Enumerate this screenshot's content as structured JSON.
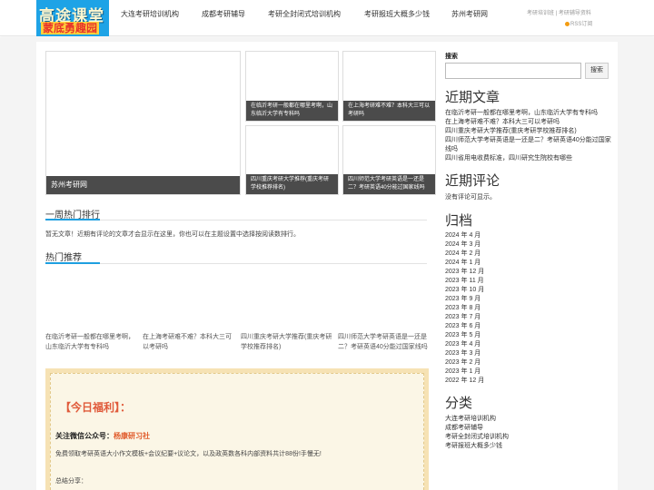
{
  "header": {
    "logo_line1": "高途课堂",
    "logo_line2": "蒙底勇趣园",
    "nav": [
      "大连考研培训机构",
      "成都考研辅导",
      "考研全封闭式培训机构",
      "考研报班大概多少钱",
      "苏州考研网"
    ],
    "top_links": [
      "考研培训班",
      "考研辅导资料"
    ],
    "top_sep": "|",
    "rss_label": "RSS订阅"
  },
  "featured": {
    "big": "苏州考研网",
    "small": [
      "在临沂考研一般都在哪里考啊，山东临沂大学有专科吗",
      "在上海考研难不难？本科大三可以考研吗",
      "四川重庆考研大学推荐(重庆考研学校推荐排名)",
      "四川师范大学考研英语是一还是二？考研英语40分能过国家线吗"
    ]
  },
  "weekly": {
    "title": "一周热门排行",
    "notice": "暂无文章！近期有评论的文章才会显示在这里，你也可以在主题设置中选择按阅读数排行。"
  },
  "hot": {
    "title": "热门推荐",
    "items": [
      "在临沂考研一般都在哪里考啊，山东临沂大学有专科吗",
      "在上海考研难不难？本科大三可以考研吗",
      "四川重庆考研大学推荐(重庆考研学校推荐排名)",
      "四川师范大学考研英语是一还是二？考研英语40分能过国家线吗"
    ]
  },
  "welfare": {
    "title": "【今日福利】：",
    "sub_prefix": "关注微信公众号：",
    "sub_name": "杨康研习社",
    "desc": "免费领取考研英语大小作文模板+会议纪要+议论文，以及政英数各科内部资料共计88份!手慢无!",
    "summary": "总结分享："
  },
  "sidebar": {
    "search_label": "搜索",
    "search_value": "",
    "search_button": "搜索",
    "recent_title": "近期文章",
    "recent": [
      "在临沂考研一般都在哪里考啊，山东临沂大学有专科吗",
      "在上海考研难不难？本科大三可以考研吗",
      "四川重庆考研大学推荐(重庆考研学校推荐排名)",
      "四川师范大学考研英语是一还是二？考研英语40分能过国家线吗",
      "四川省用电收费标准，四川研究生院校有哪些"
    ],
    "comments_title": "近期评论",
    "comments_empty": "没有评论可显示。",
    "archive_title": "归档",
    "archive": [
      "2024 年 4 月",
      "2024 年 3 月",
      "2024 年 2 月",
      "2024 年 1 月",
      "2023 年 12 月",
      "2023 年 11 月",
      "2023 年 10 月",
      "2023 年 9 月",
      "2023 年 8 月",
      "2023 年 7 月",
      "2023 年 6 月",
      "2023 年 5 月",
      "2023 年 4 月",
      "2023 年 3 月",
      "2023 年 2 月",
      "2023 年 1 月",
      "2022 年 12 月"
    ],
    "category_title": "分类",
    "categories": [
      "大连考研培训机构",
      "成都考研辅导",
      "考研全封闭式培训机构",
      "考研报班大概多少钱"
    ]
  },
  "colors": {
    "accent": "#1e9fe0",
    "logo_bg": "#1ea3e6",
    "welfare_red": "#e05a3a",
    "rss_orange": "#f39c12"
  }
}
